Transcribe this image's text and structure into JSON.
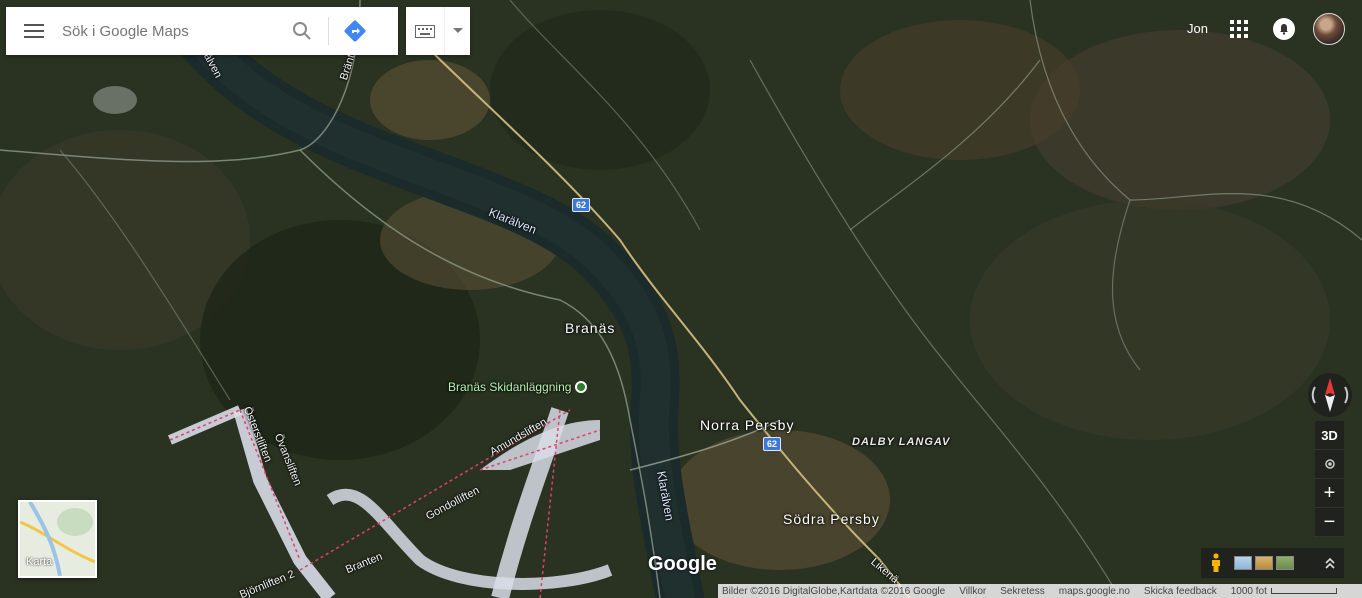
{
  "search": {
    "placeholder": "Sök i Google Maps"
  },
  "user": {
    "name": "Jon"
  },
  "map_labels": {
    "town_branas": "Branäs",
    "town_norra_persby": "Norra Persby",
    "town_sodra_persby": "Södra Persby",
    "area_dalby": "DALBY LANGAV",
    "river_1": "Klarälven",
    "river_2": "Klarälven",
    "poi_ski": "Branäs Skidanläggning",
    "lift_amund": "Amundsliften",
    "lift_gondol": "Gondolliften",
    "lift_oster": "Österstliften",
    "lift_ovans": "Övansliften",
    "lift_branten": "Branten",
    "lift_bjorn": "Björnliften 2",
    "road_liken": "Likenä",
    "road_top1": "Bränt",
    "road_top2": "rälven"
  },
  "road_shields": [
    "62",
    "62"
  ],
  "controls": {
    "three_d": "3D",
    "zoom_in": "+",
    "zoom_out": "−"
  },
  "minimap": {
    "label": "Karta"
  },
  "logo": "Google",
  "footer": {
    "imagery": "Bilder ©2016 DigitalGlobe,Kartdata ©2016 Google",
    "terms": "Villkor",
    "privacy": "Sekretess",
    "domain": "maps.google.no",
    "feedback": "Skicka feedback",
    "scale": "1000 fot"
  },
  "colors": {
    "water": "#1b2a2b",
    "road": "#c7b37a",
    "forest": "#27311f"
  }
}
